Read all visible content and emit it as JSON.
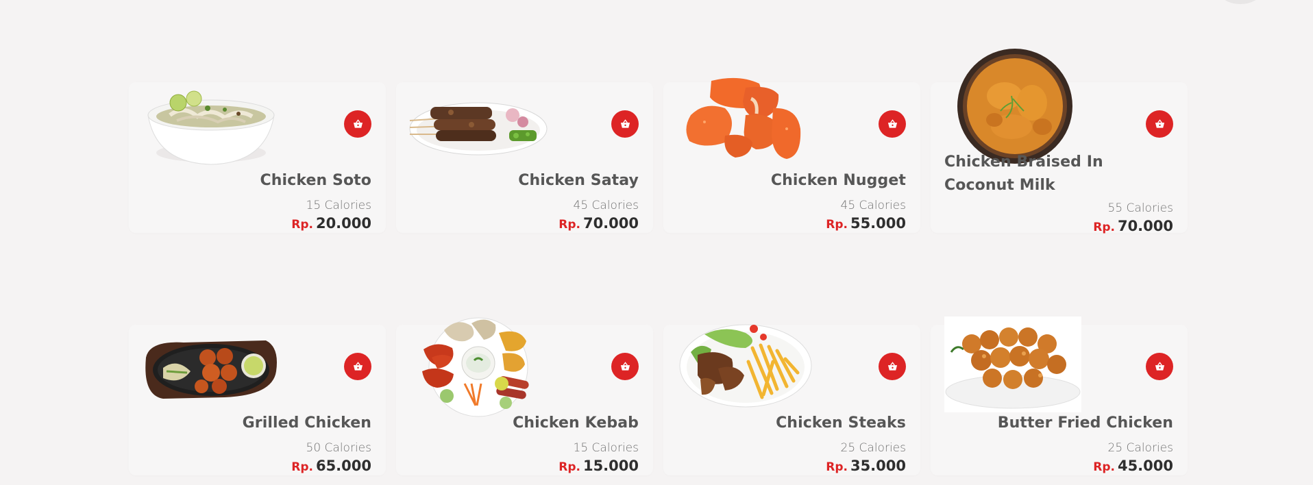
{
  "currency": "Rp.",
  "accent_color": "#dd2425",
  "cart_icon": "basket-icon",
  "products": [
    {
      "name": "Chicken Soto",
      "calories": "15 Calories",
      "price": "20.000",
      "image": "soto-bowl-image"
    },
    {
      "name": "Chicken Satay",
      "calories": "45 Calories",
      "price": "70.000",
      "image": "satay-plate-image"
    },
    {
      "name": "Chicken Nugget",
      "calories": "45 Calories",
      "price": "55.000",
      "image": "nuggets-image"
    },
    {
      "name": "Chicken Braised In Coconut Milk",
      "calories": "55 Calories",
      "price": "70.000",
      "image": "curry-bowl-image"
    },
    {
      "name": "Grilled Chicken",
      "calories": "50 Calories",
      "price": "65.000",
      "image": "sizzler-plate-image"
    },
    {
      "name": "Chicken Kebab",
      "calories": "15 Calories",
      "price": "15.000",
      "image": "kebab-platter-image"
    },
    {
      "name": "Chicken Steaks",
      "calories": "25 Calories",
      "price": "35.000",
      "image": "steak-fries-plate-image"
    },
    {
      "name": "Butter Fried Chicken",
      "calories": "25 Calories",
      "price": "45.000",
      "image": "fried-chicken-plate-image"
    }
  ]
}
